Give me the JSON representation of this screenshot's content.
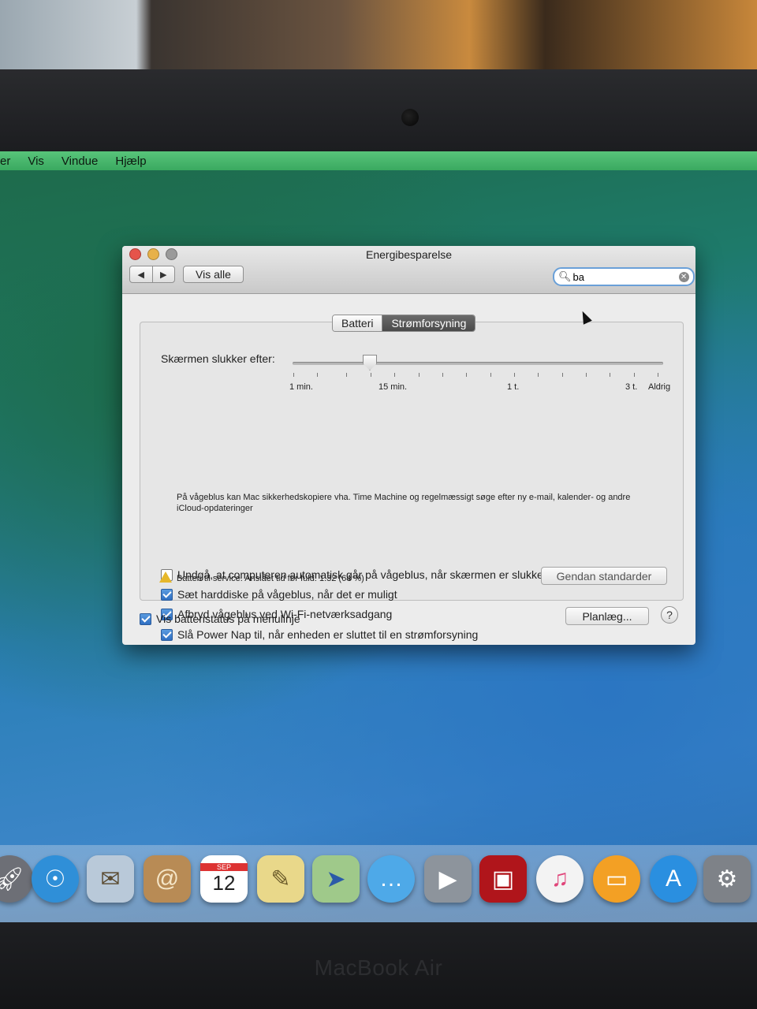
{
  "menubar": {
    "items": [
      "er",
      "Vis",
      "Vindue",
      "Hjælp"
    ]
  },
  "window": {
    "title": "Energibesparelse",
    "nav_back": "◀",
    "nav_forward": "▶",
    "show_all": "Vis alle",
    "search": {
      "value": "ba",
      "icon": "search-icon",
      "clear_icon": "clear-icon"
    }
  },
  "tabs": [
    {
      "label": "Batteri",
      "active": false
    },
    {
      "label": "Strømforsyning",
      "active": true
    }
  ],
  "slider": {
    "label": "Skærmen slukker efter:",
    "tick_labels": [
      "1 min.",
      "15 min.",
      "1 t.",
      "3 t.",
      "Aldrig"
    ],
    "selected": "15 min."
  },
  "checkboxes": [
    {
      "label": "Undgå, at computeren automatisk går på vågeblus, når skærmen er slukket",
      "checked": false
    },
    {
      "label": "Sæt harddiske på vågeblus, når det er muligt",
      "checked": true
    },
    {
      "label": "Afbryd vågeblus ved Wi-Fi-netværksadgang",
      "checked": true
    },
    {
      "label": "Slå Power Nap til, når enheden er sluttet til en strømforsyning",
      "checked": true
    }
  ],
  "power_nap_description": "På vågeblus kan Mac sikkerhedskopiere vha. Time Machine og regelmæssigt søge efter ny e-mail, kalender- og andre iCloud-opdateringer",
  "status": {
    "icon": "warning-icon",
    "text": "Batteri til service. Anslået tid før fuld: 1.32 (64 %)"
  },
  "restore_button": "Gendan standarder",
  "bottom": {
    "show_battery_label": "Vis batteristatus på menulinje",
    "show_battery_checked": true,
    "schedule_button": "Planlæg...",
    "help": "?"
  },
  "dock": {
    "items": [
      {
        "name": "launchpad-icon",
        "color": "#6d6f76"
      },
      {
        "name": "safari-icon",
        "color": "#2f8fd8"
      },
      {
        "name": "mail-icon",
        "color": "#b9c9d9"
      },
      {
        "name": "contacts-icon",
        "color": "#b88b55"
      },
      {
        "name": "calendar-icon",
        "color": "#ffffff",
        "text": "12",
        "month": "SEP"
      },
      {
        "name": "notes-icon",
        "color": "#e9d88a"
      },
      {
        "name": "maps-icon",
        "color": "#9fc98a"
      },
      {
        "name": "messages-icon",
        "color": "#4ea9e8"
      },
      {
        "name": "facetime-icon",
        "color": "#8d949c"
      },
      {
        "name": "photo-booth-icon",
        "color": "#b0151b"
      },
      {
        "name": "itunes-icon",
        "color": "#f3f3f3"
      },
      {
        "name": "ibooks-icon",
        "color": "#f3a024"
      },
      {
        "name": "app-store-icon",
        "color": "#2a8fe0"
      },
      {
        "name": "system-preferences-icon",
        "color": "#7e8288"
      }
    ]
  },
  "brand": "MacBook Air"
}
